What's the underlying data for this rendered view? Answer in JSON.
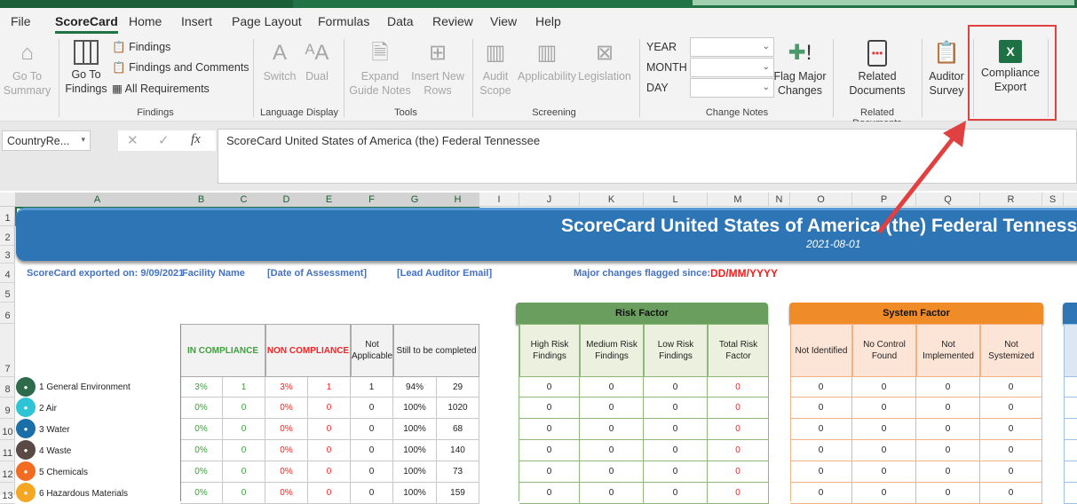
{
  "menu_tabs": [
    "File",
    "ScoreCard",
    "Home",
    "Insert",
    "Page Layout",
    "Formulas",
    "Data",
    "Review",
    "View",
    "Help"
  ],
  "active_tab": "ScoreCard",
  "ribbon": {
    "go_to_summary": "Go To Summary",
    "go_to_findings": "Go To Findings",
    "findings": "Findings",
    "findings_comments": "Findings and Comments",
    "all_requirements": "All Requirements",
    "switch": "Switch",
    "dual": "Dual",
    "expand_guide_notes": "Expand Guide Notes",
    "insert_new_rows": "Insert New Rows",
    "audit_scope": "Audit Scope",
    "applicability": "Applicability",
    "legislation": "Legislation",
    "year": "YEAR",
    "month": "MONTH",
    "day": "DAY",
    "flag_major_changes": "Flag Major Changes",
    "related_documents": "Related Documents",
    "auditor_survey": "Auditor Survey",
    "compliance_export": "Compliance Export",
    "groups": {
      "findings": "Findings",
      "language": "Language Display",
      "tools": "Tools",
      "screening": "Screening",
      "change_notes": "Change Notes",
      "related": "Related Documents"
    }
  },
  "name_box": "CountryRe...",
  "formula": "ScoreCard United States of America (the) Federal Tennessee",
  "columns": [
    "A",
    "B",
    "C",
    "D",
    "E",
    "F",
    "G",
    "H",
    "I",
    "J",
    "K",
    "L",
    "M",
    "N",
    "O",
    "P",
    "Q",
    "R",
    "S"
  ],
  "rows": [
    "1",
    "2",
    "3",
    "4",
    "5",
    "6",
    "7",
    "8",
    "9",
    "10",
    "11",
    "12",
    "13"
  ],
  "banner": {
    "title": "ScoreCard United States of America (the) Federal Tennessee",
    "date": "2021-08-01"
  },
  "info": {
    "exported": "ScoreCard exported on: 9/09/2021",
    "facility": "Facility Name",
    "date_assessment": "[Date of Assessment]",
    "auditor_email": "[Lead Auditor Email]",
    "flagged": "Major changes flagged since:",
    "flagged_value": "DD/MM/YYYY"
  },
  "compliance_headers": {
    "in": "IN COMPLIANCE",
    "non": "NON COMPLIANCE",
    "na": "Not Applicable",
    "todo": "Still to be completed"
  },
  "risk": {
    "title": "Risk Factor",
    "cols": [
      "High Risk Findings",
      "Medium Risk Findings",
      "Low Risk Findings",
      "Total Risk Factor"
    ]
  },
  "system": {
    "title": "System Factor",
    "cols": [
      "Not Identified",
      "No Control Found",
      "Not Implemented",
      "Not Systemized"
    ]
  },
  "categories": [
    {
      "name": "1 General Environment",
      "color": "#2e6b4a",
      "icon": "tree",
      "in_pct": "3%",
      "in": "1",
      "non_pct": "3%",
      "non": "1",
      "na": "1",
      "todo_pct": "94%",
      "todo": "29",
      "risk": [
        "0",
        "0",
        "0",
        "0"
      ],
      "sys": [
        "0",
        "0",
        "0",
        "0"
      ]
    },
    {
      "name": "2 Air",
      "color": "#2ec4d6",
      "icon": "factory",
      "in_pct": "0%",
      "in": "0",
      "non_pct": "0%",
      "non": "0",
      "na": "0",
      "todo_pct": "100%",
      "todo": "1020",
      "risk": [
        "0",
        "0",
        "0",
        "0"
      ],
      "sys": [
        "0",
        "0",
        "0",
        "0"
      ]
    },
    {
      "name": "3 Water",
      "color": "#1a6fa8",
      "icon": "drop",
      "in_pct": "0%",
      "in": "0",
      "non_pct": "0%",
      "non": "0",
      "na": "0",
      "todo_pct": "100%",
      "todo": "68",
      "risk": [
        "0",
        "0",
        "0",
        "0"
      ],
      "sys": [
        "0",
        "0",
        "0",
        "0"
      ]
    },
    {
      "name": "4 Waste",
      "color": "#5a4a45",
      "icon": "truck",
      "in_pct": "0%",
      "in": "0",
      "non_pct": "0%",
      "non": "0",
      "na": "0",
      "todo_pct": "100%",
      "todo": "140",
      "risk": [
        "0",
        "0",
        "0",
        "0"
      ],
      "sys": [
        "0",
        "0",
        "0",
        "0"
      ]
    },
    {
      "name": "5 Chemicals",
      "color": "#f26b21",
      "icon": "skull",
      "in_pct": "0%",
      "in": "0",
      "non_pct": "0%",
      "non": "0",
      "na": "0",
      "todo_pct": "100%",
      "todo": "73",
      "risk": [
        "0",
        "0",
        "0",
        "0"
      ],
      "sys": [
        "0",
        "0",
        "0",
        "0"
      ]
    },
    {
      "name": "6 Hazardous Materials",
      "color": "#f5a623",
      "icon": "biohazard",
      "in_pct": "0%",
      "in": "0",
      "non_pct": "0%",
      "non": "0",
      "na": "0",
      "todo_pct": "100%",
      "todo": "159",
      "risk": [
        "0",
        "0",
        "0",
        "0"
      ],
      "sys": [
        "0",
        "0",
        "0",
        "0"
      ]
    }
  ]
}
